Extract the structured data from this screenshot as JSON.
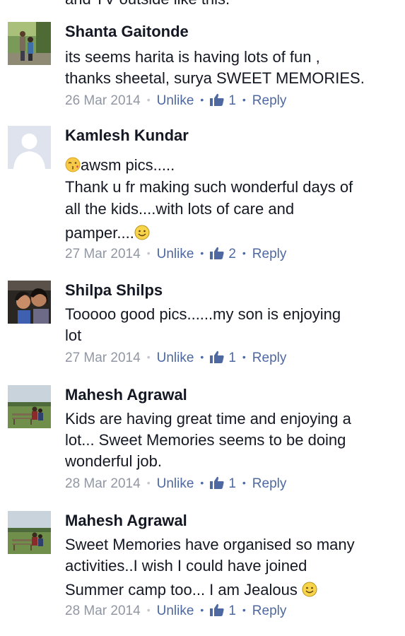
{
  "top_cut_text": "and TV outside like this.",
  "comments": [
    {
      "author": "Shanta Gaitonde",
      "lines": [
        "its seems harita is having lots of fun ,",
        "thanks sheetal, surya SWEET MEMORIES."
      ],
      "date": "26 Mar 2014",
      "unlike": "Unlike",
      "likes": "1",
      "reply": "Reply"
    },
    {
      "author": "Kamlesh Kundar",
      "lines": [
        "awsm pics.....",
        "Thank u fr making such wonderful days of",
        "all the kids....with lots of care and",
        "pamper...."
      ],
      "date": "27 Mar 2014",
      "unlike": "Unlike",
      "likes": "2",
      "reply": "Reply"
    },
    {
      "author": "Shilpa Shilps",
      "lines": [
        "Tooooo good pics......my son is enjoying",
        "lot"
      ],
      "date": "27 Mar 2014",
      "unlike": "Unlike",
      "likes": "1",
      "reply": "Reply"
    },
    {
      "author": "Mahesh Agrawal",
      "lines": [
        "Kids are having great time and enjoying a",
        "lot... Sweet Memories seems to be doing",
        "wonderful job."
      ],
      "date": "28 Mar 2014",
      "unlike": "Unlike",
      "likes": "1",
      "reply": "Reply"
    },
    {
      "author": "Mahesh Agrawal",
      "lines": [
        "Sweet Memories have organised so many",
        "activities..I wish I could have joined",
        "Summer camp too... I am Jealous "
      ],
      "date": "28 Mar 2014",
      "unlike": "Unlike",
      "likes": "1",
      "reply": "Reply"
    }
  ],
  "icons": {
    "like": "thumbs-up-icon",
    "emoji_kiss": "kiss-emoji-icon",
    "emoji_smile": "smile-emoji-icon"
  },
  "colors": {
    "link": "#4e69a2",
    "meta": "#9197a3",
    "text": "#141823"
  }
}
